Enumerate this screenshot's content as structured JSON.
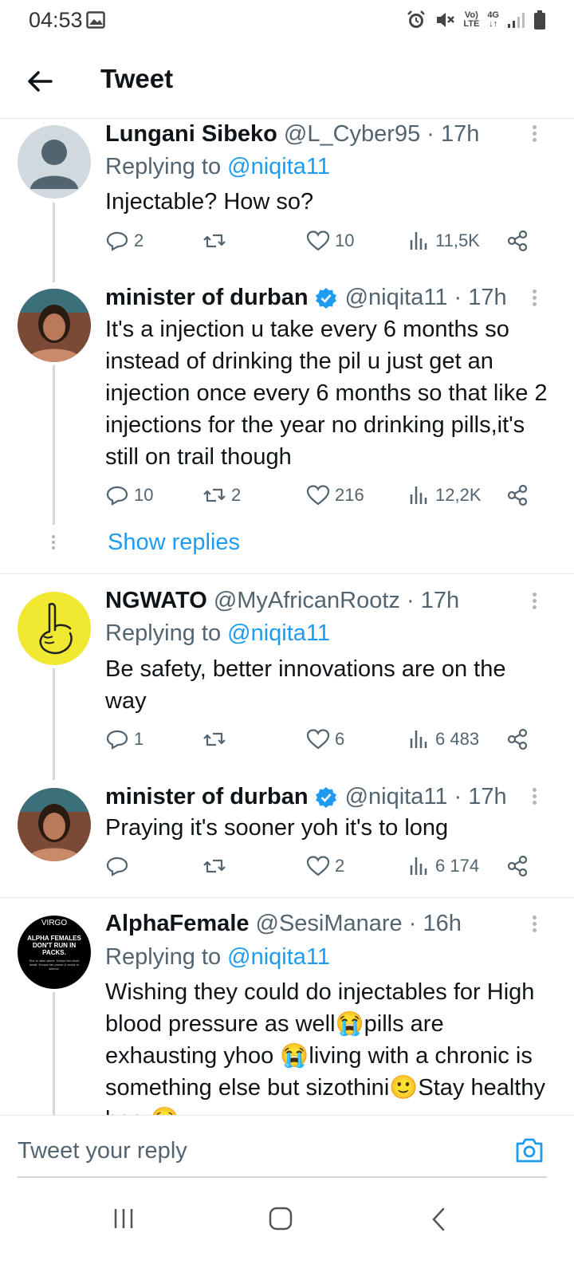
{
  "status_bar": {
    "time": "04:53",
    "network_top": "Vo)",
    "network_bottom": "LTE",
    "gen": "4G"
  },
  "header": {
    "title": "Tweet"
  },
  "tweets": [
    {
      "name": "Lungani Sibeko",
      "handle": "@L_Cyber95",
      "time": "· 17h",
      "verified": false,
      "replying_label": "Replying to",
      "replying_to": "@niqita11",
      "text": "Injectable? How so?",
      "replies": "2",
      "retweets": "",
      "likes": "10",
      "views": "11,5K"
    },
    {
      "name": "minister of durban",
      "handle": "@niqita11",
      "time": "· 17h",
      "verified": true,
      "text": "It's a injection u take every 6 months so instead of drinking the pil u just get an injection once every 6 months so that like 2 injections for the year no drinking pills,it's still on trail though",
      "replies": "10",
      "retweets": "2",
      "likes": "216",
      "views": "12,2K"
    },
    {
      "name": "NGWATO",
      "handle": "@MyAfricanRootz",
      "time": "· 17h",
      "verified": false,
      "replying_label": "Replying to",
      "replying_to": "@niqita11",
      "text": "Be safety, better innovations are on the way",
      "replies": "1",
      "retweets": "",
      "likes": "6",
      "views": "6 483"
    },
    {
      "name": "minister of durban",
      "handle": "@niqita11",
      "time": "· 17h",
      "verified": true,
      "text": "Praying it's sooner yoh it's to long",
      "replies": "",
      "retweets": "",
      "likes": "2",
      "views": "6 174"
    },
    {
      "name": "AlphaFemale",
      "handle": "@SesiManare",
      "time": "· 16h",
      "verified": false,
      "replying_label": "Replying to",
      "replying_to": "@niqita11",
      "text": "Wishing they could do injectables for High blood pressure as well😭pills are exhausting yhoo 😭living with a chronic is something else but sizothini🙂Stay healthy boo 😢"
    }
  ],
  "show_replies": "Show replies",
  "alpha_avatar": {
    "top": "VIRGO",
    "line1": "ALPHA FEMALES",
    "line2": "DON'T RUN IN",
    "line3": "PACKS.",
    "small": "She is often alone. Keeps her circle small. Knows her power & works in silence."
  },
  "reply_bar": {
    "placeholder": "Tweet your reply"
  },
  "colors": {
    "accent": "#1d9bf0",
    "text": "#0f1419",
    "secondary": "#536471"
  }
}
